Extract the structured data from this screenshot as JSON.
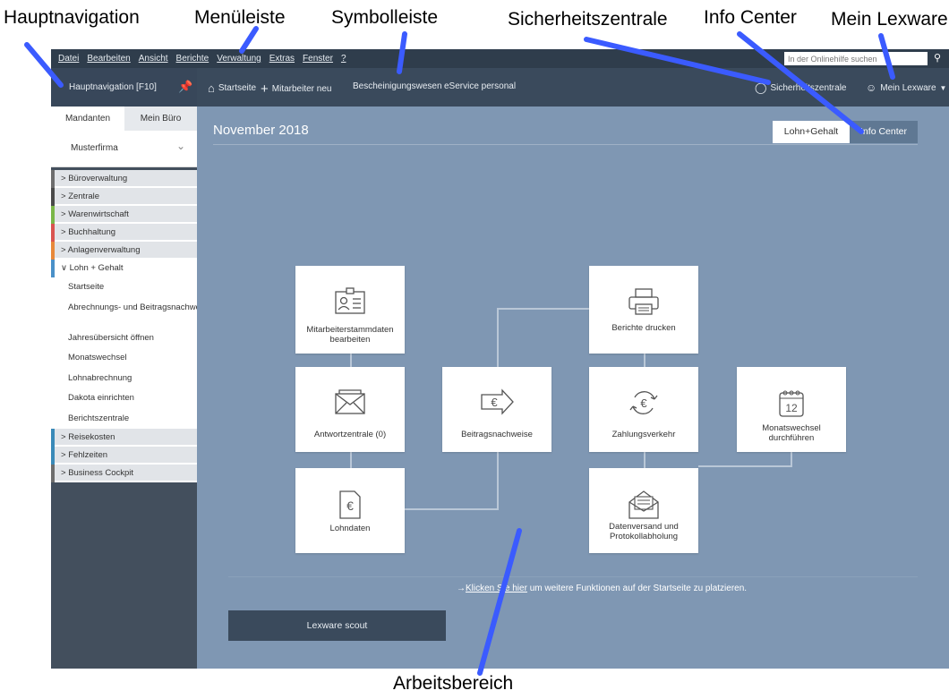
{
  "callouts": {
    "hauptnavigation": "Hauptnavigation",
    "menuleiste": "Menüleiste",
    "symbolleiste": "Symbolleiste",
    "sicherheitszentrale": "Sicherheitszentrale",
    "info_center": "Info Center",
    "mein_lexware": "Mein Lexware",
    "arbeitsbereich": "Arbeitsbereich"
  },
  "menubar": {
    "items": [
      "Datei",
      "Bearbeiten",
      "Ansicht",
      "Berichte",
      "Verwaltung",
      "Extras",
      "Fenster",
      "?"
    ],
    "help_search_placeholder": "In der Onlinehilfe suchen"
  },
  "toolbar": {
    "hauptnavigation_label": "Hauptnavigation [F10]",
    "startseite": "Startseite",
    "mitarbeiter_neu": "Mitarbeiter neu",
    "bescheinigungswesen": "Bescheinigungswesen",
    "eservice": "eService personal",
    "sicherheitszentrale": "Sicherheitszentrale",
    "mein_lexware": "Mein Lexware"
  },
  "sidebar": {
    "tabs": [
      "Mandanten",
      "Mein Büro"
    ],
    "company": "Musterfirma",
    "groups": [
      {
        "label": "Büroverwaltung",
        "color": "#6d6d6d"
      },
      {
        "label": "Zentrale",
        "color": "#4a4a4a"
      },
      {
        "label": "Warenwirtschaft",
        "color": "#7ab648"
      },
      {
        "label": "Buchhaltung",
        "color": "#d9534f"
      },
      {
        "label": "Anlagenverwaltung",
        "color": "#e8883a"
      },
      {
        "label": "Lohn + Gehalt",
        "color": "#4a90c8"
      },
      {
        "label": "Reisekosten",
        "color": "#3a8ab8"
      },
      {
        "label": "Fehlzeiten",
        "color": "#3a8ab8"
      },
      {
        "label": "Business Cockpit",
        "color": "#6d6d6d"
      }
    ],
    "lohn_items": [
      "Startseite",
      "Abrechnungs- und Beitragsnachweis-Assistent",
      "Jahresübersicht öffnen",
      "Monatswechsel",
      "Lohnabrechnung",
      "Dakota einrichten",
      "Berichtszentrale"
    ]
  },
  "main": {
    "month": "November 2018",
    "toggle": [
      "Lohn+Gehalt",
      "Info Center"
    ],
    "tiles": {
      "mitarbeiter": "Mitarbeiterstammdaten bearbeiten",
      "antwort": "Antwortzentrale (0)",
      "lohndaten": "Lohndaten",
      "beitrag": "Beitragsnachweise",
      "berichte": "Berichte drucken",
      "zahlung": "Zahlungsverkehr",
      "datenversand": "Datenversand und Protokollabholung",
      "monatswechsel": "Monatswechsel durchführen"
    },
    "hint_prefix": "→",
    "hint_link": "Klicken Sie hier",
    "hint_rest": " um weitere Funktionen auf der Startseite zu platzieren.",
    "scout": "Lexware scout"
  },
  "colors": {
    "arrow": "#3b5bff",
    "sidebar_dark": "#434f5d",
    "workarea": "#7f97b3"
  }
}
